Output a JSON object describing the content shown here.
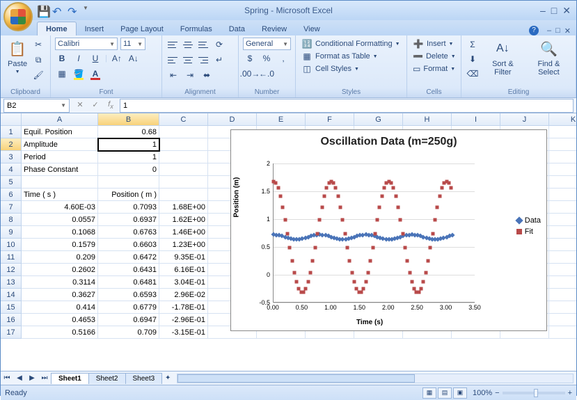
{
  "app": {
    "title": "Spring - Microsoft Excel"
  },
  "tabs": [
    "Home",
    "Insert",
    "Page Layout",
    "Formulas",
    "Data",
    "Review",
    "View"
  ],
  "activeTab": 0,
  "ribbon": {
    "clipboard": {
      "paste": "Paste",
      "label": "Clipboard"
    },
    "font": {
      "name": "Calibri",
      "size": "11",
      "label": "Font"
    },
    "alignment": {
      "label": "Alignment"
    },
    "number": {
      "format": "General",
      "label": "Number"
    },
    "styles": {
      "cf": "Conditional Formatting",
      "fat": "Format as Table",
      "cs": "Cell Styles",
      "label": "Styles"
    },
    "cells": {
      "ins": "Insert",
      "del": "Delete",
      "fmt": "Format",
      "label": "Cells"
    },
    "editing": {
      "sort": "Sort & Filter",
      "find": "Find & Select",
      "label": "Editing"
    }
  },
  "namebox": "B2",
  "formula": "1",
  "columns": [
    "A",
    "B",
    "C",
    "D",
    "E",
    "F",
    "G",
    "H",
    "I",
    "J",
    "K"
  ],
  "rows": [
    {
      "n": 1,
      "A": "Equil. Position",
      "B": "0.68",
      "C": ""
    },
    {
      "n": 2,
      "A": "Amplitude",
      "B": "1",
      "C": ""
    },
    {
      "n": 3,
      "A": "Period",
      "B": "1",
      "C": ""
    },
    {
      "n": 4,
      "A": "Phase Constant",
      "B": "0",
      "C": ""
    },
    {
      "n": 5,
      "A": "",
      "B": "",
      "C": ""
    },
    {
      "n": 6,
      "A": "Time ( s )",
      "B": "Position ( m )",
      "C": ""
    },
    {
      "n": 7,
      "A": "4.60E-03",
      "B": "0.7093",
      "C": "1.68E+00"
    },
    {
      "n": 8,
      "A": "0.0557",
      "B": "0.6937",
      "C": "1.62E+00"
    },
    {
      "n": 9,
      "A": "0.1068",
      "B": "0.6763",
      "C": "1.46E+00"
    },
    {
      "n": 10,
      "A": "0.1579",
      "B": "0.6603",
      "C": "1.23E+00"
    },
    {
      "n": 11,
      "A": "0.209",
      "B": "0.6472",
      "C": "9.35E-01"
    },
    {
      "n": 12,
      "A": "0.2602",
      "B": "0.6431",
      "C": "6.16E-01"
    },
    {
      "n": 13,
      "A": "0.3114",
      "B": "0.6481",
      "C": "3.04E-01"
    },
    {
      "n": 14,
      "A": "0.3627",
      "B": "0.6593",
      "C": "2.96E-02"
    },
    {
      "n": 15,
      "A": "0.414",
      "B": "0.6779",
      "C": "-1.78E-01"
    },
    {
      "n": 16,
      "A": "0.4653",
      "B": "0.6947",
      "C": "-2.96E-01"
    },
    {
      "n": 17,
      "A": "0.5166",
      "B": "0.709",
      "C": "-3.15E-01"
    }
  ],
  "activeCell": {
    "row": 2,
    "col": "B"
  },
  "chart_data": {
    "type": "scatter",
    "title": "Oscillation Data (m=250g)",
    "xlabel": "Time (s)",
    "ylabel": "Position (m)",
    "xlim": [
      0,
      3.5
    ],
    "ylim": [
      -0.5,
      2
    ],
    "xticks": [
      0.0,
      0.5,
      1.0,
      1.5,
      2.0,
      2.5,
      3.0,
      3.5
    ],
    "yticks": [
      -0.5,
      0,
      0.5,
      1,
      1.5,
      2
    ],
    "series": [
      {
        "name": "Data",
        "marker": "diamond",
        "color": "#4a74b8",
        "note": "flat measured positions ~0.68 m with small oscillation amplitude ~0.07m",
        "sample_x": [
          0.0046,
          0.5,
          1.0,
          1.5,
          2.0,
          2.5,
          3.0
        ],
        "sample_y": [
          0.71,
          0.68,
          0.68,
          0.68,
          0.68,
          0.68,
          0.68
        ]
      },
      {
        "name": "Fit",
        "marker": "square",
        "color": "#b84a4a",
        "note": "modeled sinusoid y = 0.68 + 1*cos(2π t / 1 + 0)",
        "params": {
          "equil": 0.68,
          "amplitude": 1,
          "period": 1,
          "phase": 0
        }
      }
    ],
    "legend": [
      "Data",
      "Fit"
    ]
  },
  "sheets": [
    "Sheet1",
    "Sheet2",
    "Sheet3"
  ],
  "activeSheet": 0,
  "status": {
    "ready": "Ready",
    "zoom": "100%"
  }
}
